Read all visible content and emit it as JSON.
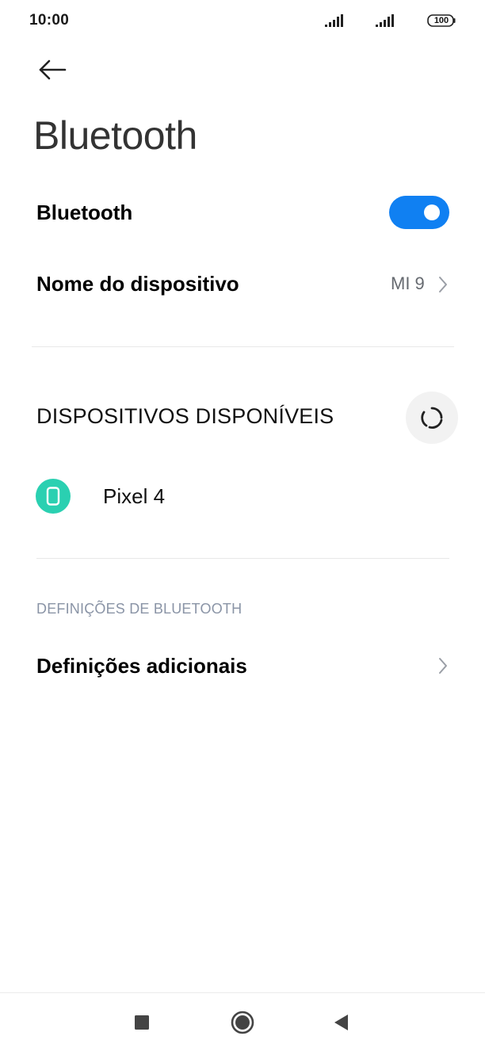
{
  "status_bar": {
    "time": "10:00",
    "battery_level": "100",
    "icons": [
      "signal-icon",
      "signal-icon",
      "battery-icon"
    ]
  },
  "header": {
    "back_icon": "arrow-left-icon",
    "title": "Bluetooth"
  },
  "bluetooth_toggle": {
    "label": "Bluetooth",
    "enabled": true,
    "accent_color": "#1080f2"
  },
  "device_name": {
    "label": "Nome do dispositivo",
    "value": "MI 9"
  },
  "available_devices": {
    "heading": "DISPOSITIVOS DISPONÍVEIS",
    "refresh_icon": "refresh-icon",
    "items": [
      {
        "name": "Pixel 4",
        "icon": "phone-icon",
        "icon_color": "#2ad0b1"
      }
    ]
  },
  "bluetooth_settings": {
    "heading": "DEFINIÇÕES DE BLUETOOTH",
    "additional_label": "Definições adicionais"
  },
  "nav_bar": {
    "icons": [
      "recents-icon",
      "home-icon",
      "back-icon"
    ]
  }
}
